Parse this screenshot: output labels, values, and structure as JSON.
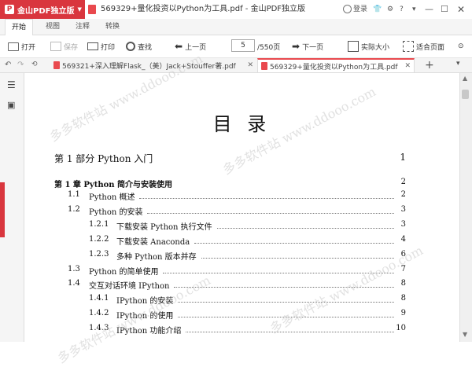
{
  "app": {
    "badge": "金山PDF独立版",
    "title": "569329+量化投资以Python为工具.pdf - 金山PDF独立版",
    "login": "登录"
  },
  "menu": {
    "tabs": [
      "开始",
      "视图",
      "注释",
      "转换"
    ]
  },
  "toolbar": {
    "open": "打开",
    "save": "保存",
    "print": "打印",
    "find": "查找",
    "prev": "上一页",
    "page_value": "5",
    "page_total": "/550页",
    "next": "下一页",
    "actual_size": "实际大小",
    "fit_page": "适合页面"
  },
  "doc_tabs": [
    {
      "label": "569321+深入理解Flask_（美）Jack+Stouffer著.pdf"
    },
    {
      "label": "569329+量化投资以Python为工具.pdf"
    }
  ],
  "toc": {
    "heading": "目   录",
    "part": {
      "label": "第 1 部分   Python 入门",
      "page": "1"
    },
    "chapter": {
      "label": "第 1 章   Python 简介与安装使用",
      "page": "2"
    },
    "entries": [
      {
        "num": "1.1",
        "label": "Python 概述",
        "page": "2"
      },
      {
        "num": "1.2",
        "label": "Python 的安装",
        "page": "3"
      },
      {
        "num": "1.2.1",
        "label": "下载安装 Python 执行文件",
        "page": "3"
      },
      {
        "num": "1.2.2",
        "label": "下载安装 Anaconda",
        "page": "4"
      },
      {
        "num": "1.2.3",
        "label": "多种 Python 版本并存",
        "page": "6"
      },
      {
        "num": "1.3",
        "label": "Python 的简单使用",
        "page": "7"
      },
      {
        "num": "1.4",
        "label": "交互对话环境 IPython",
        "page": "8"
      },
      {
        "num": "1.4.1",
        "label": "IPython 的安装",
        "page": "8"
      },
      {
        "num": "1.4.2",
        "label": "IPython 的使用",
        "page": "9"
      },
      {
        "num": "1.4.3",
        "label": "IPython 功能介绍",
        "page": "10"
      }
    ]
  },
  "watermark": "多多软件站 www.ddooo.com"
}
